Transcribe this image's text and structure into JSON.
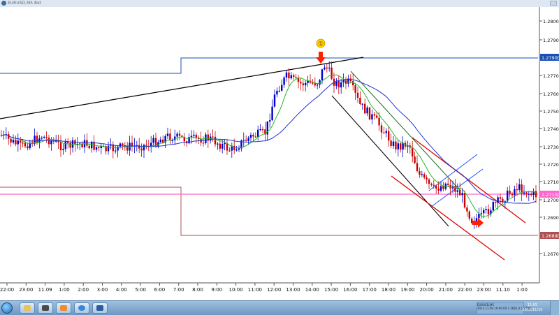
{
  "window": {
    "title": "EURUSD,M5 Bid"
  },
  "colors": {
    "up_candle": "#0000cc",
    "down_candle": "#cc0000",
    "ma_fast": "#22bb22",
    "ma_slow": "#2233cc",
    "trendline": "#000000",
    "channel": "#e00000",
    "small_channel": "#2255ff",
    "level_box": "#1a4fb5",
    "pink_line": "#ff66cc",
    "marker_arrow": "#ff2200",
    "callout_circle": "#ffd400"
  },
  "callout": {
    "label": "①"
  },
  "price_axis": {
    "ticks": [
      "1.2800[0]",
      "1.2790[5]",
      "1.2780[0]",
      "1.2770[0]",
      "1.2760[0]",
      "1.2750[0]",
      "1.2740[0]",
      "1.2730[0]",
      "1.2720[0]",
      "1.2710[0]",
      "1.2700[0]",
      "1.2690[0]",
      "1.2680[0]",
      "1.2670[0]"
    ],
    "price_labels": [
      "1.2790[5]",
      "1.2710[5]",
      "1.2689[0]"
    ]
  },
  "time_axis": {
    "ticks": [
      "22:00",
      "23:00",
      "11.09",
      "1:00",
      "2:00",
      "3:00",
      "4:00",
      "5:00",
      "6:00",
      "7:00",
      "8:00",
      "9:00",
      "10:00",
      "11:00",
      "12:00",
      "13:00",
      "14:00",
      "15:00",
      "16:00",
      "17:00",
      "18:00",
      "19:00",
      "20:00",
      "21:00",
      "22:00",
      "23:00",
      "11.10",
      "1:00"
    ]
  },
  "taskbar": {
    "buttons": [
      "windows-explorer",
      "media-player",
      "outlook",
      "internet-explorer",
      "trading-terminal"
    ],
    "tray_text": [
      "EURUSD,M5",
      "2012.11.09 19:00:00 1.2681.0 1.27[0]"
    ],
    "clock_time": "11:05",
    "clock_date": "2012/11/10"
  }
}
